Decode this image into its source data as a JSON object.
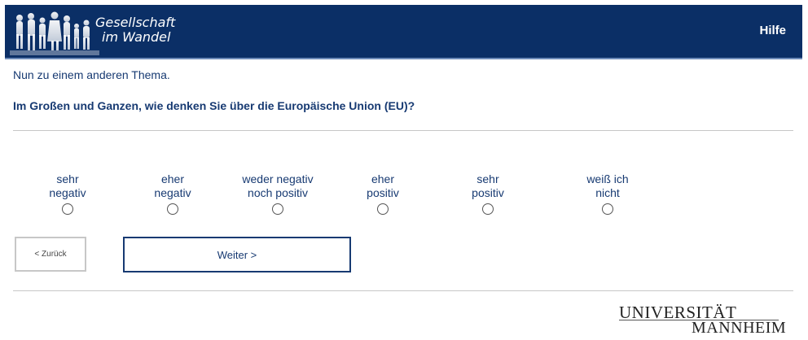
{
  "header": {
    "logo_line1": "Gesellschaft",
    "logo_line2": "im Wandel",
    "help_label": "Hilfe",
    "colors": {
      "background": "#0b2f66",
      "accent": "#6d8bb8"
    }
  },
  "intro": "Nun zu einem anderen Thema.",
  "question": "Im Großen und Ganzen, wie denken Sie über die Europäische Union (EU)?",
  "options": [
    {
      "line1": "sehr",
      "line2": "negativ"
    },
    {
      "line1": "eher",
      "line2": "negativ"
    },
    {
      "line1": "weder negativ",
      "line2": "noch positiv"
    },
    {
      "line1": "eher",
      "line2": "positiv"
    },
    {
      "line1": "sehr",
      "line2": "positiv"
    },
    {
      "line1": "weiß ich",
      "line2": "nicht"
    }
  ],
  "buttons": {
    "back_label": "< Zurück",
    "next_label": "Weiter >"
  },
  "footer": {
    "university_line1": "UNIVERSITÄT",
    "university_line2": "MANNHEIM"
  }
}
